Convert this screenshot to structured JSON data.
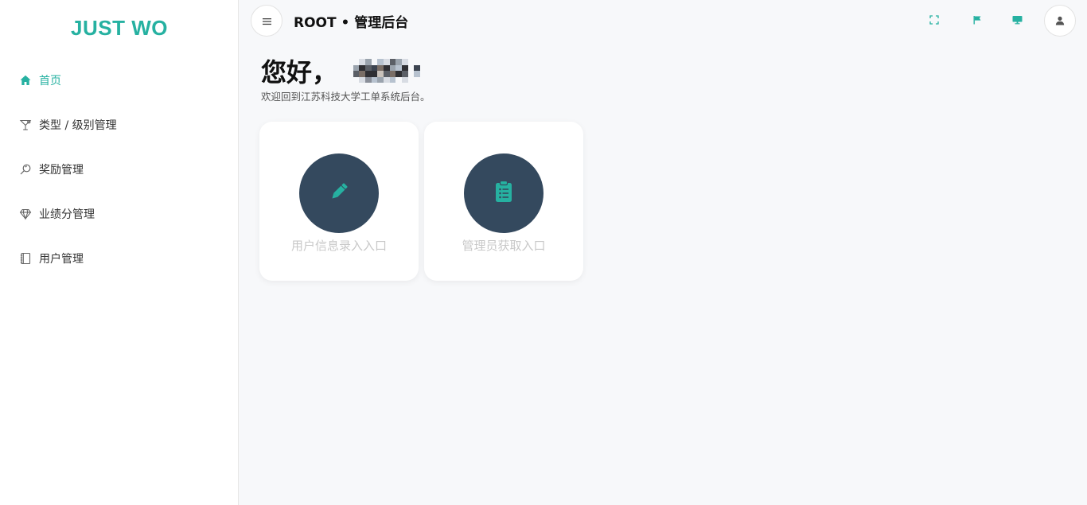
{
  "sidebar": {
    "logo": "JUST WO",
    "items": [
      {
        "label": "首页",
        "icon": "home-icon",
        "active": true
      },
      {
        "label": "类型 / 级别管理",
        "icon": "cocktail-icon"
      },
      {
        "label": "奖励管理",
        "icon": "magnifier-icon"
      },
      {
        "label": "业绩分管理",
        "icon": "diamond-icon"
      },
      {
        "label": "用户管理",
        "icon": "notebook-icon"
      }
    ]
  },
  "header": {
    "title": "ROOT • 管理后台",
    "tools": [
      "fullscreen-icon",
      "flag-icon",
      "monitor-icon"
    ],
    "menu_icon": "hamburger-icon",
    "avatar_icon": "user-icon"
  },
  "main": {
    "greeting": "您好，",
    "subtitle": "欢迎回到江苏科技大学工单系统后台。",
    "cards": [
      {
        "label": "用户信息录入入口",
        "icon": "pencil-icon"
      },
      {
        "label": "管理员获取入口",
        "icon": "clipboard-list-icon"
      }
    ]
  },
  "colors": {
    "accent": "#26b1a1",
    "card_circle": "#34495e",
    "background": "#f7f8fa"
  }
}
